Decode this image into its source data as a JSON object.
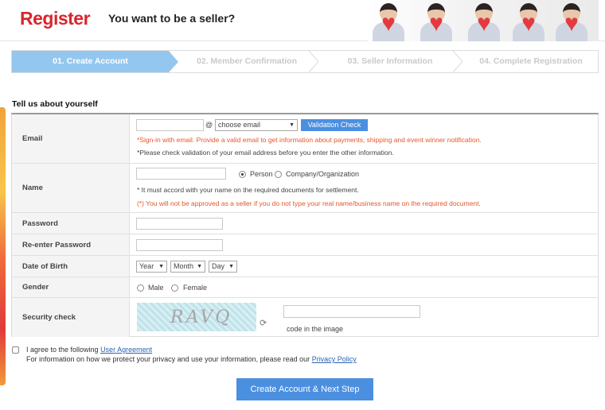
{
  "header": {
    "logo": "Register",
    "tagline": "You want to be a seller?"
  },
  "steps": [
    {
      "label": "01. Create Account",
      "active": true
    },
    {
      "label": "02. Member Confirmation",
      "active": false
    },
    {
      "label": "03. Seller Information",
      "active": false
    },
    {
      "label": "04. Complete Registration",
      "active": false
    }
  ],
  "section_title": "Tell us about yourself",
  "form": {
    "email": {
      "label": "Email",
      "at": "@",
      "domain_select": "choose email",
      "validation_button": "Validation Check",
      "note1": "*Sign-in with email. Provide a valid email to get information about payments, shipping and event winner notification.",
      "note2": "*Please check validation of your email address before you enter the other information."
    },
    "name": {
      "label": "Name",
      "option_person": "Person",
      "option_company": "Company/Organization",
      "note1": "* It must accord with your name on the required documents for settlement.",
      "note2": "(*) You will not be approved as a seller if you do not type your real name/business name on the required document."
    },
    "password": {
      "label": "Password"
    },
    "reenter_password": {
      "label": "Re-enter Password"
    },
    "dob": {
      "label": "Date of Birth",
      "year": "Year",
      "month": "Month",
      "day": "Day"
    },
    "gender": {
      "label": "Gender",
      "male": "Male",
      "female": "Female"
    },
    "security": {
      "label": "Security check",
      "captcha_text": "RAVQ",
      "hint": "code in the image"
    }
  },
  "agreement": {
    "line1_prefix": "I agree to the following ",
    "user_agreement_link": "User Agreement",
    "line2_prefix": "For information on how we protect your privacy and use your information, please read our ",
    "privacy_link": "Privacy Policy"
  },
  "submit_label": "Create Account & Next Step",
  "colors": {
    "brand_red": "#d8262d",
    "step_active": "#94c7ef",
    "button_blue": "#4b8fe0",
    "note_red": "#e4572c"
  }
}
